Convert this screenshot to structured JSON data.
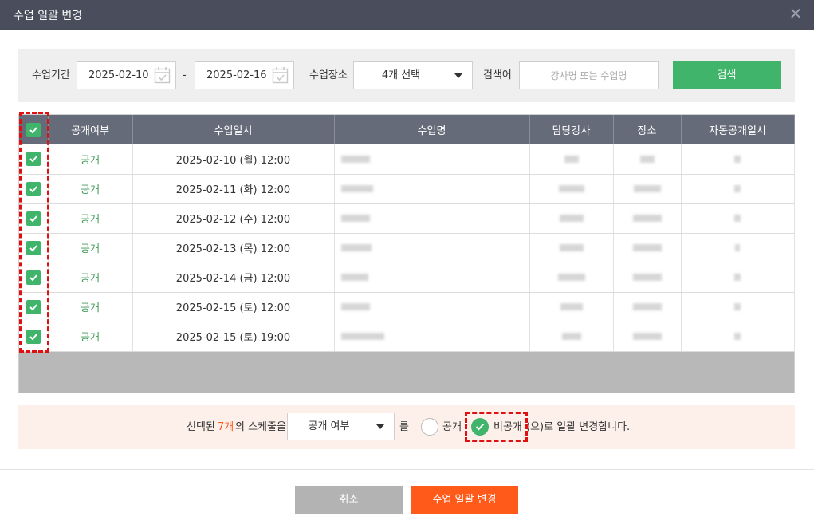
{
  "dialog": {
    "title": "수업 일괄 변경"
  },
  "filter": {
    "period_label": "수업기간",
    "start_date": "2025-02-10",
    "separator": "-",
    "end_date": "2025-02-16",
    "place_label": "수업장소",
    "place_value": "4개 선택",
    "keyword_label": "검색어",
    "keyword_placeholder": "강사명 또는 수업명",
    "search_label": "검색"
  },
  "table": {
    "headers": [
      "공개여부",
      "수업일시",
      "수업명",
      "담당강사",
      "장소",
      "자동공개일시"
    ],
    "rows": [
      {
        "status": "공개",
        "datetime": "2025-02-10 (월) 12:00",
        "checked": true
      },
      {
        "status": "공개",
        "datetime": "2025-02-11 (화) 12:00",
        "checked": true
      },
      {
        "status": "공개",
        "datetime": "2025-02-12 (수) 12:00",
        "checked": true
      },
      {
        "status": "공개",
        "datetime": "2025-02-13 (목) 12:00",
        "checked": true
      },
      {
        "status": "공개",
        "datetime": "2025-02-14 (금) 12:00",
        "checked": true
      },
      {
        "status": "공개",
        "datetime": "2025-02-15 (토) 12:00",
        "checked": true
      },
      {
        "status": "공개",
        "datetime": "2025-02-15 (토) 19:00",
        "checked": true
      }
    ]
  },
  "bulk": {
    "prefix": "선택된",
    "count": "7개",
    "suffix": "의 스케줄을",
    "field_value": "공개 여부",
    "particle": "를",
    "option_public": "공개",
    "option_private": "비공개",
    "ending": "(으)로 일괄 변경합니다.",
    "selected_option": "비공개"
  },
  "footer": {
    "cancel_label": "취소",
    "apply_label": "수업 일괄 변경"
  },
  "colors": {
    "accent_green": "#3fb46a",
    "accent_orange": "#ff5a1a",
    "header_dark": "#4a4e5c"
  }
}
